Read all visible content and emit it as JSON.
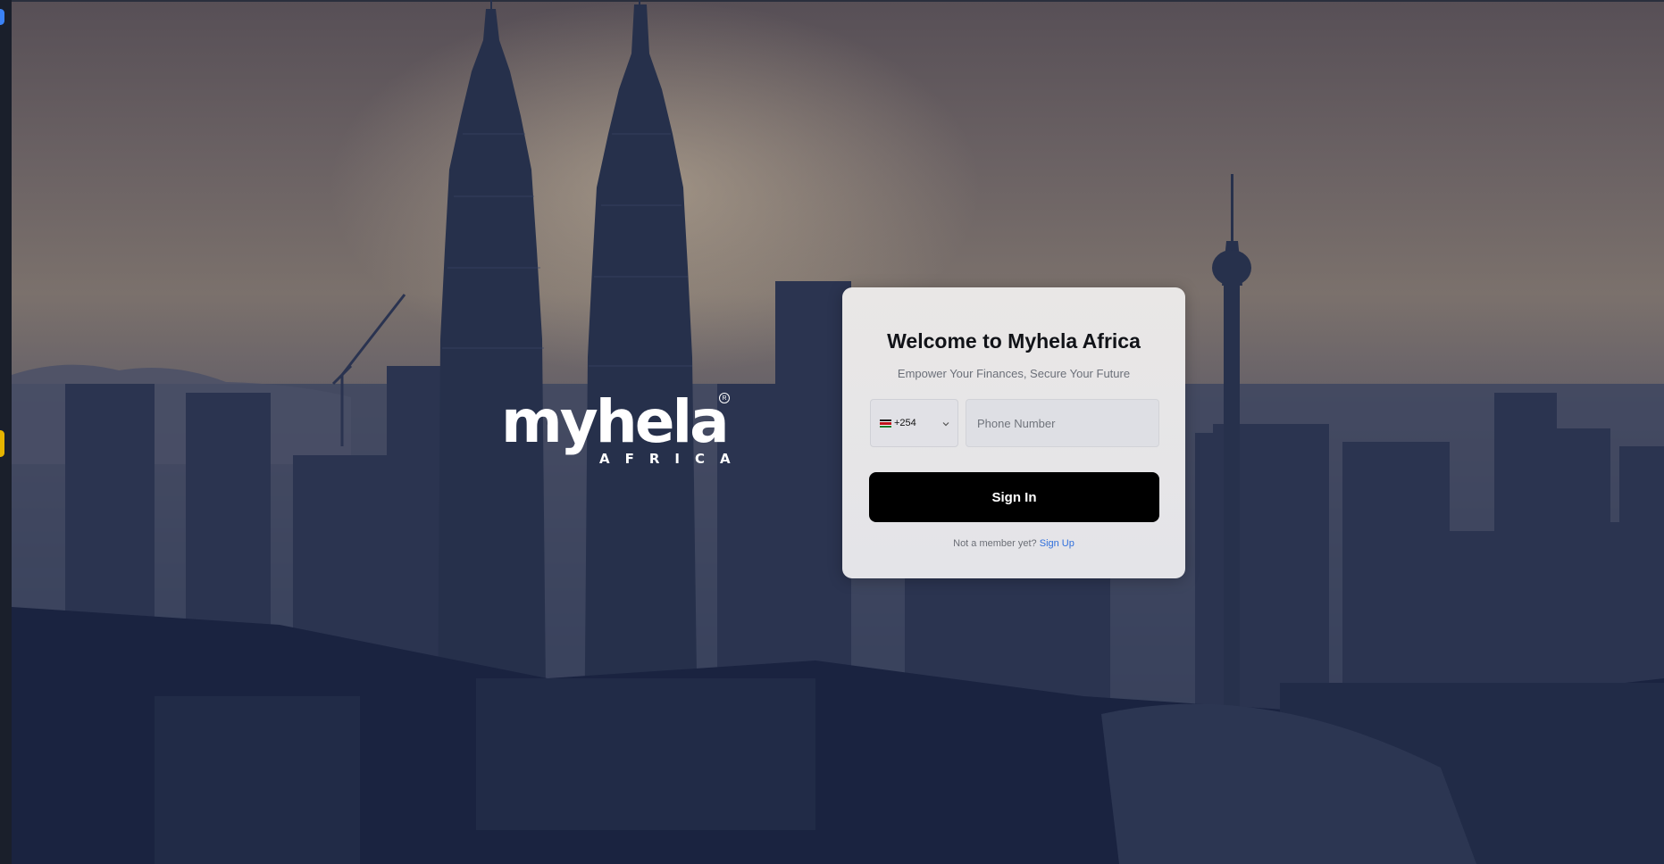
{
  "brand": {
    "logo_word": "myhela",
    "logo_sub": "AFRICA",
    "registered_mark": "R"
  },
  "login": {
    "title": "Welcome to Myhela Africa",
    "subtitle": "Empower Your Finances, Secure Your Future",
    "country_code": "+254",
    "country_flag": "kenya-flag-icon",
    "phone_placeholder": "Phone Number",
    "phone_value": "",
    "signin_label": "Sign In",
    "signup_prompt": "Not a member yet?",
    "signup_link": "Sign Up"
  },
  "colors": {
    "button_bg": "#000000",
    "link": "#2f6fdc",
    "card_bg": "#e6e6e8"
  }
}
